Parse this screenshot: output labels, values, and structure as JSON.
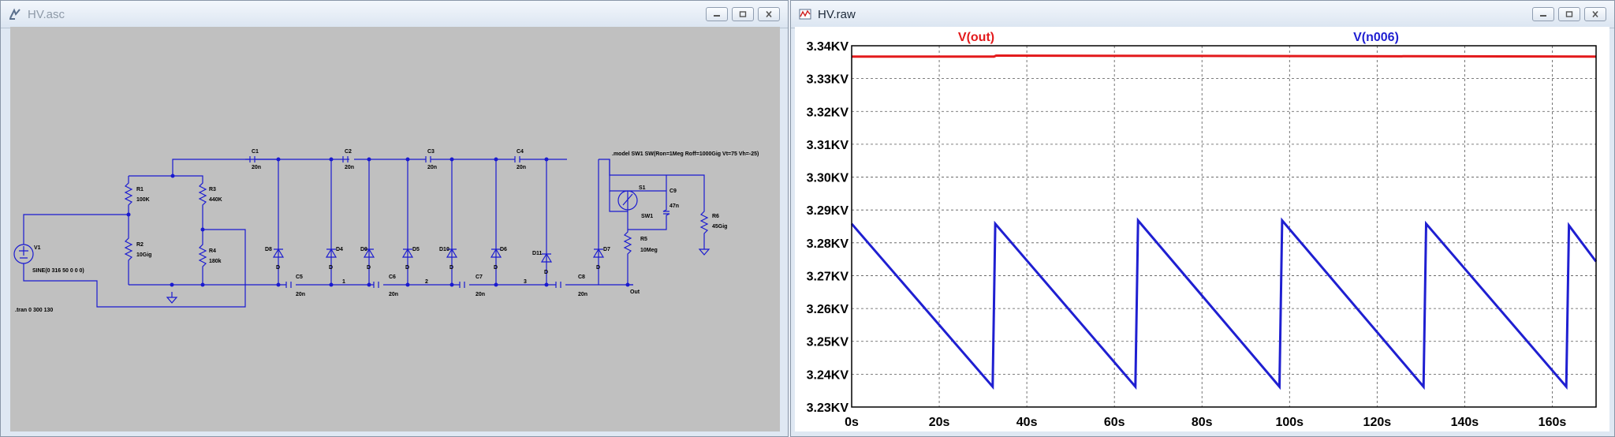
{
  "schematic_window": {
    "title": "HV.asc",
    "components": {
      "V1": "V1",
      "V1_value": "SINE(0 316 50 0 0 0)",
      "R1": "R1",
      "R1_value": "100K",
      "R2": "R2",
      "R2_value": "10Gig",
      "R3": "R3",
      "R3_value": "440K",
      "R4": "R4",
      "R4_value": "180k",
      "C1": "C1",
      "C1_value": "20n",
      "C2": "C2",
      "C2_value": "20n",
      "C3": "C3",
      "C3_value": "20n",
      "C4": "C4",
      "C4_value": "20n",
      "C5": "C5",
      "C5_value": "20n",
      "C6": "C6",
      "C6_value": "20n",
      "C7": "C7",
      "C7_value": "20n",
      "C8": "C8",
      "C8_value": "20n",
      "C9": "C9",
      "C9_value": "47n",
      "D8": "D8",
      "D4": "D4",
      "D9": "D9",
      "D5": "D5",
      "D10": "D10",
      "D6": "D6",
      "D11": "D11",
      "D7": "D7",
      "diode_model": "D",
      "S1": "S1",
      "S1_model": "SW1",
      "R5": "R5",
      "R5_value": "10Meg",
      "R6": "R6",
      "R6_value": "45Gig",
      "node1": "1",
      "node2": "2",
      "node3": "3",
      "node_out": "Out"
    },
    "model_directive": ".model SW1 SW(Ron=1Meg Roff=1000Gig Vt=75 Vh=-25)",
    "tran_directive": ".tran 0 300 130"
  },
  "waveform_window": {
    "title": "HV.raw",
    "colors": {
      "vout": "#e31a1c",
      "vn006": "#1f1fd1"
    }
  },
  "chart_data": {
    "type": "line",
    "title": "",
    "xlabel": "",
    "ylabel": "",
    "xlim": [
      0,
      170
    ],
    "ylim": [
      3.23,
      3.34
    ],
    "x_ticks": [
      "0s",
      "20s",
      "40s",
      "60s",
      "80s",
      "100s",
      "120s",
      "140s",
      "160s"
    ],
    "x_tick_values": [
      0,
      20,
      40,
      60,
      80,
      100,
      120,
      140,
      160
    ],
    "y_ticks": [
      "3.34KV",
      "3.33KV",
      "3.32KV",
      "3.31KV",
      "3.30KV",
      "3.29KV",
      "3.28KV",
      "3.27KV",
      "3.26KV",
      "3.25KV",
      "3.24KV",
      "3.23KV"
    ],
    "y_tick_values": [
      3.34,
      3.33,
      3.32,
      3.31,
      3.3,
      3.29,
      3.28,
      3.27,
      3.26,
      3.25,
      3.24,
      3.23
    ],
    "grid": true,
    "series": [
      {
        "name": "V(out)",
        "color": "#e31a1c",
        "x": [
          0,
          32.5,
          33,
          170
        ],
        "y": [
          3.3367,
          3.3367,
          3.337,
          3.3367
        ]
      },
      {
        "name": "V(n006)",
        "color": "#1f1fd1",
        "x": [
          0,
          32.2,
          32.8,
          64.8,
          65.4,
          97.7,
          98.3,
          130.6,
          131.2,
          163.2,
          163.8,
          170
        ],
        "y": [
          3.2858,
          3.2362,
          3.2858,
          3.2362,
          3.2868,
          3.2362,
          3.2868,
          3.2362,
          3.2858,
          3.2362,
          3.2853,
          3.2743
        ]
      }
    ]
  }
}
